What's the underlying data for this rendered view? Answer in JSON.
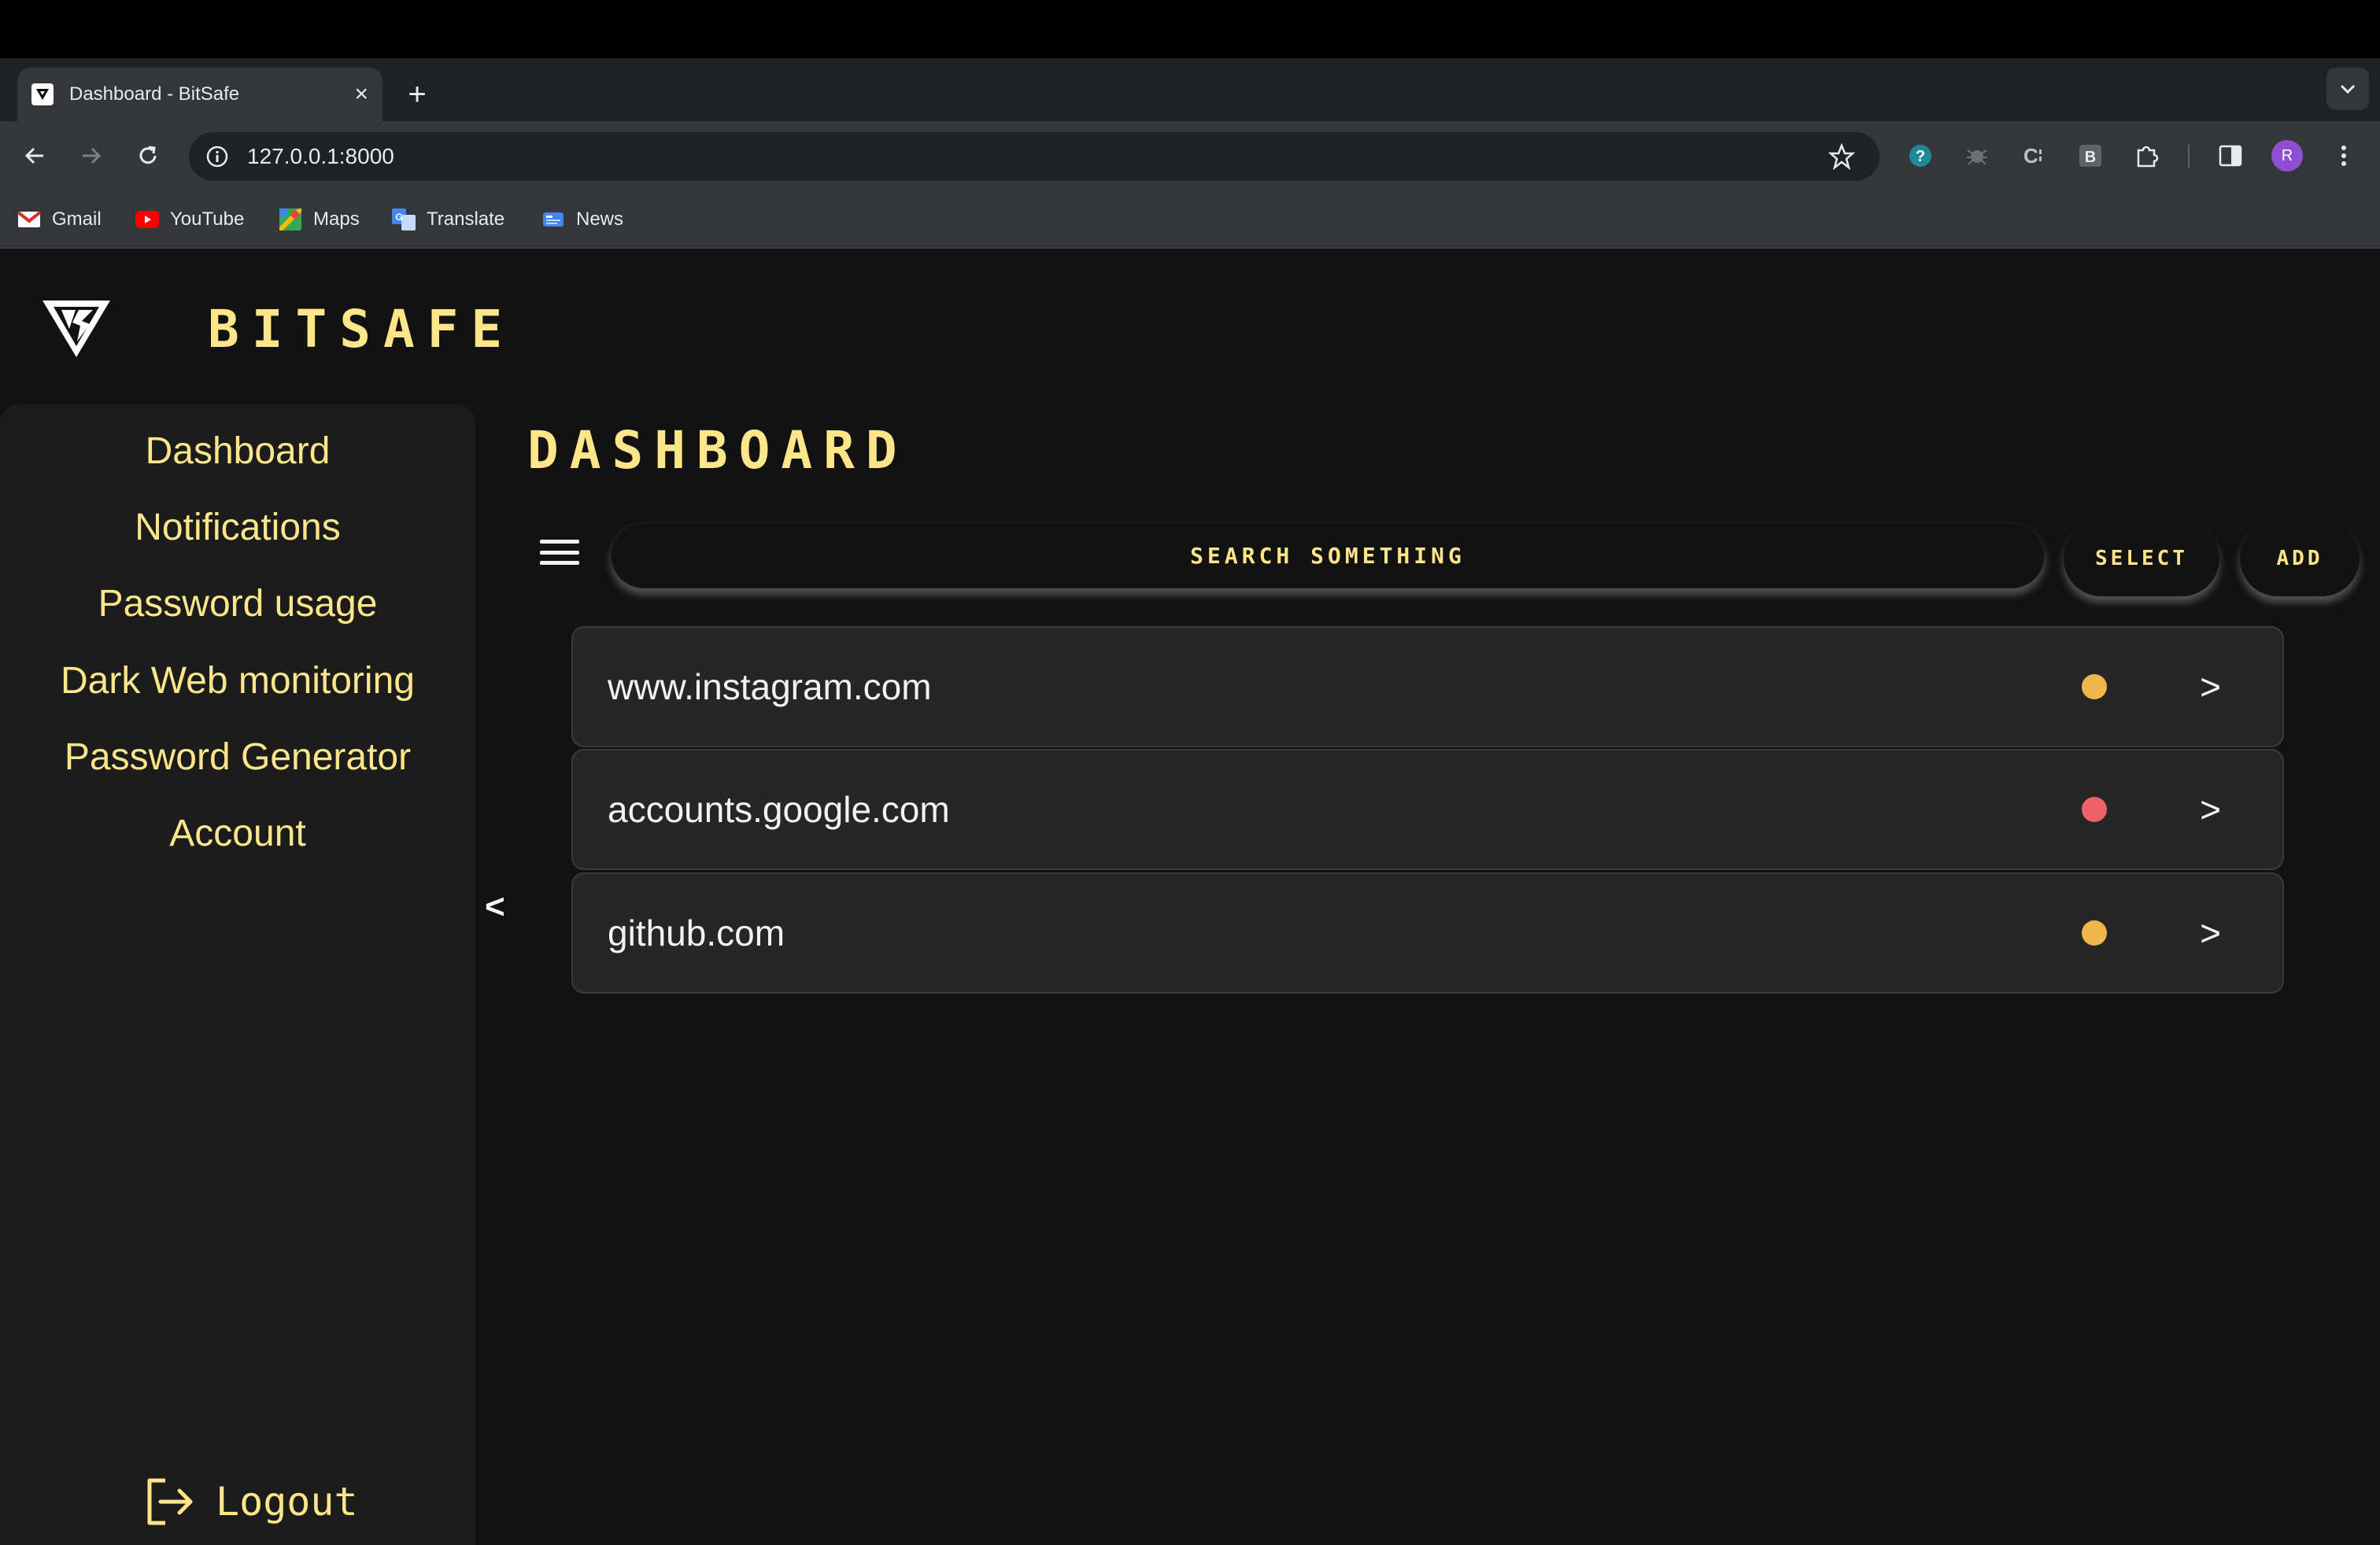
{
  "browser": {
    "tab_title": "Dashboard - BitSafe",
    "url": "127.0.0.1:8000",
    "avatar_letter": "R",
    "bookmarks": [
      {
        "label": "Gmail",
        "icon": "gmail-icon"
      },
      {
        "label": "YouTube",
        "icon": "youtube-icon"
      },
      {
        "label": "Maps",
        "icon": "maps-icon"
      },
      {
        "label": "Translate",
        "icon": "translate-icon"
      },
      {
        "label": "News",
        "icon": "news-icon"
      }
    ]
  },
  "app": {
    "brand": "BITSAFE",
    "page_title": "DASHBOARD",
    "sidebar": {
      "items": [
        {
          "label": "Dashboard"
        },
        {
          "label": "Notifications"
        },
        {
          "label": "Password usage"
        },
        {
          "label": "Dark Web monitoring"
        },
        {
          "label": "Password Generator"
        },
        {
          "label": "Account"
        }
      ],
      "logout_label": "Logout",
      "collapse_label": "<"
    },
    "search": {
      "placeholder": "SEARCH SOMETHING"
    },
    "buttons": {
      "select": "SELECT",
      "add": "ADD"
    },
    "sites": [
      {
        "name": "www.instagram.com",
        "status_color": "#f0b84a",
        "chevron": ">"
      },
      {
        "name": "accounts.google.com",
        "status_color": "#ec6468",
        "chevron": ">"
      },
      {
        "name": "github.com",
        "status_color": "#f0b84a",
        "chevron": ">"
      }
    ]
  },
  "colors": {
    "accent": "#fde68a",
    "background": "#121212",
    "sidebar": "#1c1c1c",
    "row": "#262626"
  }
}
